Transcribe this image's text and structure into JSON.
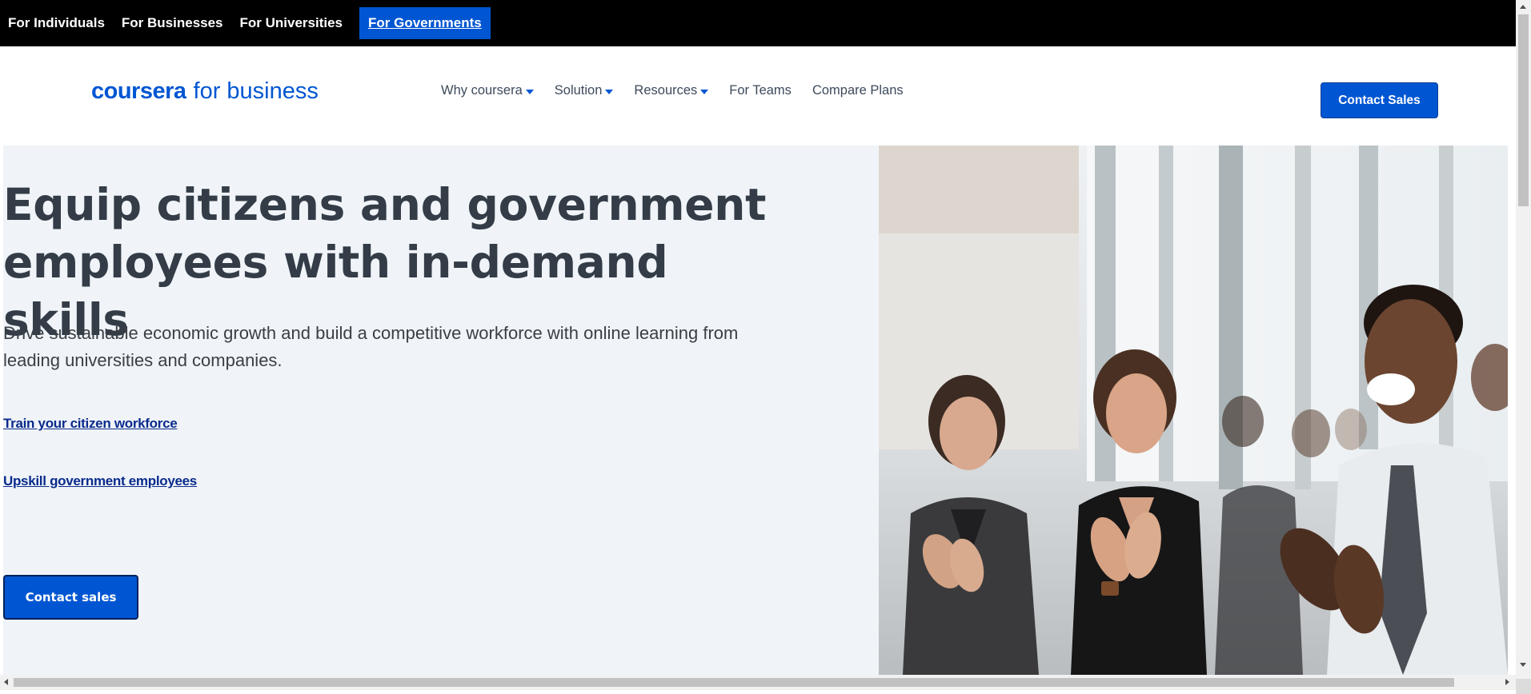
{
  "audience_nav": {
    "items": [
      {
        "label": "For Individuals"
      },
      {
        "label": "For Businesses"
      },
      {
        "label": "For Universities"
      },
      {
        "label": "For Governments"
      }
    ]
  },
  "header": {
    "logo_brand": "coursera",
    "logo_sub": "for business",
    "nav": [
      {
        "label": "Why coursera",
        "has_dropdown": true
      },
      {
        "label": "Solution",
        "has_dropdown": true
      },
      {
        "label": "Resources",
        "has_dropdown": true
      },
      {
        "label": "For Teams",
        "has_dropdown": false
      },
      {
        "label": "Compare Plans",
        "has_dropdown": false
      }
    ],
    "cta_label": "Contact Sales"
  },
  "hero": {
    "title": "Equip citizens and government employees with in-demand skills",
    "description": "Drive sustainable economic growth and build a competitive workforce with online learning from leading universities and companies.",
    "links": [
      {
        "label": "Train your citizen workforce"
      },
      {
        "label": "Upskill government employees"
      }
    ],
    "cta_label": "Contact sales"
  },
  "colors": {
    "brand_blue": "#0056d2",
    "top_bar": "#000000",
    "hero_bg": "#f0f4f8",
    "heading": "#333c47"
  }
}
